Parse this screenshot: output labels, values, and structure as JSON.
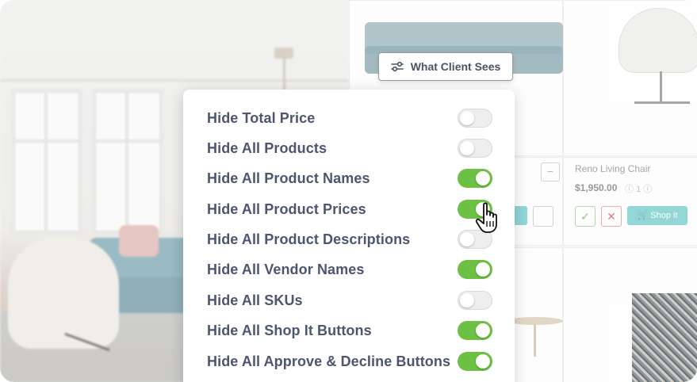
{
  "header_button": {
    "label": "What Client Sees",
    "icon": "sliders-icon"
  },
  "settings": [
    {
      "key": "total-price",
      "label": "Hide Total Price",
      "enabled": false
    },
    {
      "key": "all-products",
      "label": "Hide All Products",
      "enabled": false
    },
    {
      "key": "product-names",
      "label": "Hide All Product Names",
      "enabled": true
    },
    {
      "key": "product-prices",
      "label": "Hide All Product Prices",
      "enabled": true
    },
    {
      "key": "product-descriptions",
      "label": "Hide All Product Descriptions",
      "enabled": false
    },
    {
      "key": "vendor-names",
      "label": "Hide All Vendor Names",
      "enabled": true
    },
    {
      "key": "skus",
      "label": "Hide All SKUs",
      "enabled": false
    },
    {
      "key": "shop-it-buttons",
      "label": "Hide All Shop It Buttons",
      "enabled": true
    },
    {
      "key": "approve-decline-buttons",
      "label": "Hide All Approve & Decline Buttons",
      "enabled": true
    }
  ],
  "background_product": {
    "name": "Reno Living Chair",
    "price": "$1,950.00",
    "quantity": "1",
    "shop_label": "Shop it"
  },
  "colors": {
    "toggle_on": "#6cc043",
    "toggle_off": "#eeeeee",
    "label_text": "#4c5670"
  }
}
